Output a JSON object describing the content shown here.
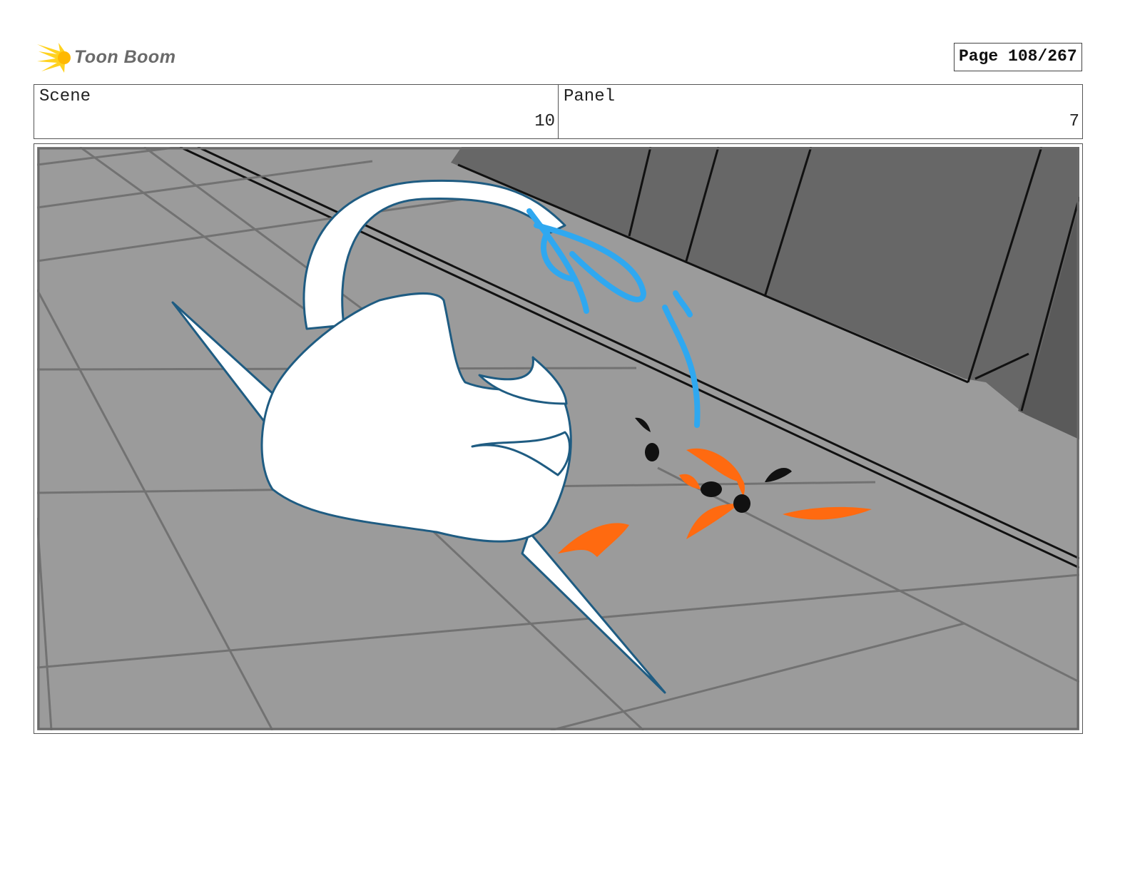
{
  "header": {
    "logo_text": "Toon Boom",
    "logo_icon": "toon-boom-burst-icon",
    "page_label": "Page 108/267"
  },
  "info": {
    "scene_label": "Scene",
    "scene_value": "10",
    "panel_label": "Panel",
    "panel_value": "7"
  },
  "panel_image": {
    "description_icon": "storyboard-sketch",
    "colors": {
      "floor": "#9a9a9a",
      "wall": "#676767",
      "outline": "#1f5c82",
      "water": "#2fa8f0",
      "spark": "#ff6a10"
    }
  }
}
